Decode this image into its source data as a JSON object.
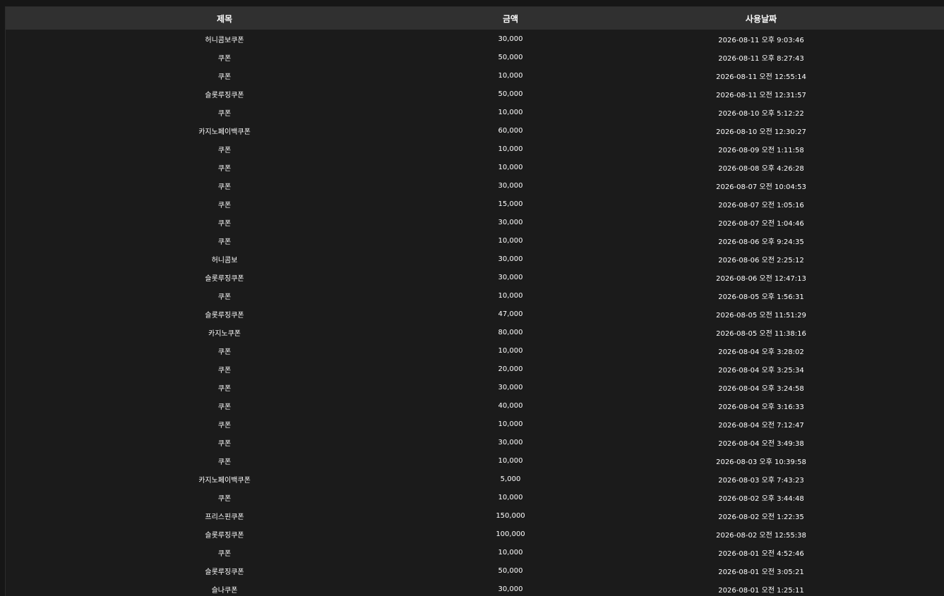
{
  "columns": {
    "title": "제목",
    "amount": "금액",
    "date": "사용날짜"
  },
  "rows": [
    {
      "title": "허니콤보쿠폰",
      "amount": "30,000",
      "date": "2026-08-11 오후 9:03:46"
    },
    {
      "title": "쿠폰",
      "amount": "50,000",
      "date": "2026-08-11 오후 8:27:43"
    },
    {
      "title": "쿠폰",
      "amount": "10,000",
      "date": "2026-08-11 오전 12:55:14"
    },
    {
      "title": "슬롯루징쿠폰",
      "amount": "50,000",
      "date": "2026-08-11 오전 12:31:57"
    },
    {
      "title": "쿠폰",
      "amount": "10,000",
      "date": "2026-08-10 오후 5:12:22"
    },
    {
      "title": "카지노페이백쿠폰",
      "amount": "60,000",
      "date": "2026-08-10 오전 12:30:27"
    },
    {
      "title": "쿠폰",
      "amount": "10,000",
      "date": "2026-08-09 오전 1:11:58"
    },
    {
      "title": "쿠폰",
      "amount": "10,000",
      "date": "2026-08-08 오후 4:26:28"
    },
    {
      "title": "쿠폰",
      "amount": "30,000",
      "date": "2026-08-07 오전 10:04:53"
    },
    {
      "title": "쿠폰",
      "amount": "15,000",
      "date": "2026-08-07 오전 1:05:16"
    },
    {
      "title": "쿠폰",
      "amount": "30,000",
      "date": "2026-08-07 오전 1:04:46"
    },
    {
      "title": "쿠폰",
      "amount": "10,000",
      "date": "2026-08-06 오후 9:24:35"
    },
    {
      "title": "허니콤보",
      "amount": "30,000",
      "date": "2026-08-06 오전 2:25:12"
    },
    {
      "title": "슬롯루징쿠폰",
      "amount": "30,000",
      "date": "2026-08-06 오전 12:47:13"
    },
    {
      "title": "쿠폰",
      "amount": "10,000",
      "date": "2026-08-05 오후 1:56:31"
    },
    {
      "title": "슬롯루징쿠폰",
      "amount": "47,000",
      "date": "2026-08-05 오전 11:51:29"
    },
    {
      "title": "카지노쿠폰",
      "amount": "80,000",
      "date": "2026-08-05 오전 11:38:16"
    },
    {
      "title": "쿠폰",
      "amount": "10,000",
      "date": "2026-08-04 오후 3:28:02"
    },
    {
      "title": "쿠폰",
      "amount": "20,000",
      "date": "2026-08-04 오후 3:25:34"
    },
    {
      "title": "쿠폰",
      "amount": "30,000",
      "date": "2026-08-04 오후 3:24:58"
    },
    {
      "title": "쿠폰",
      "amount": "40,000",
      "date": "2026-08-04 오후 3:16:33"
    },
    {
      "title": "쿠폰",
      "amount": "10,000",
      "date": "2026-08-04 오전 7:12:47"
    },
    {
      "title": "쿠폰",
      "amount": "30,000",
      "date": "2026-08-04 오전 3:49:38"
    },
    {
      "title": "쿠폰",
      "amount": "10,000",
      "date": "2026-08-03 오후 10:39:58"
    },
    {
      "title": "카지노페이백쿠폰",
      "amount": "5,000",
      "date": "2026-08-03 오후 7:43:23"
    },
    {
      "title": "쿠폰",
      "amount": "10,000",
      "date": "2026-08-02 오후 3:44:48"
    },
    {
      "title": "프리스핀쿠폰",
      "amount": "150,000",
      "date": "2026-08-02 오전 1:22:35"
    },
    {
      "title": "슬롯루징쿠폰",
      "amount": "100,000",
      "date": "2026-08-02 오전 12:55:38"
    },
    {
      "title": "쿠폰",
      "amount": "10,000",
      "date": "2026-08-01 오전 4:52:46"
    },
    {
      "title": "슬롯루징쿠폰",
      "amount": "50,000",
      "date": "2026-08-01 오전 3:05:21"
    },
    {
      "title": "슬나쿠폰",
      "amount": "30,000",
      "date": "2026-08-01 오전 1:25:11"
    }
  ]
}
